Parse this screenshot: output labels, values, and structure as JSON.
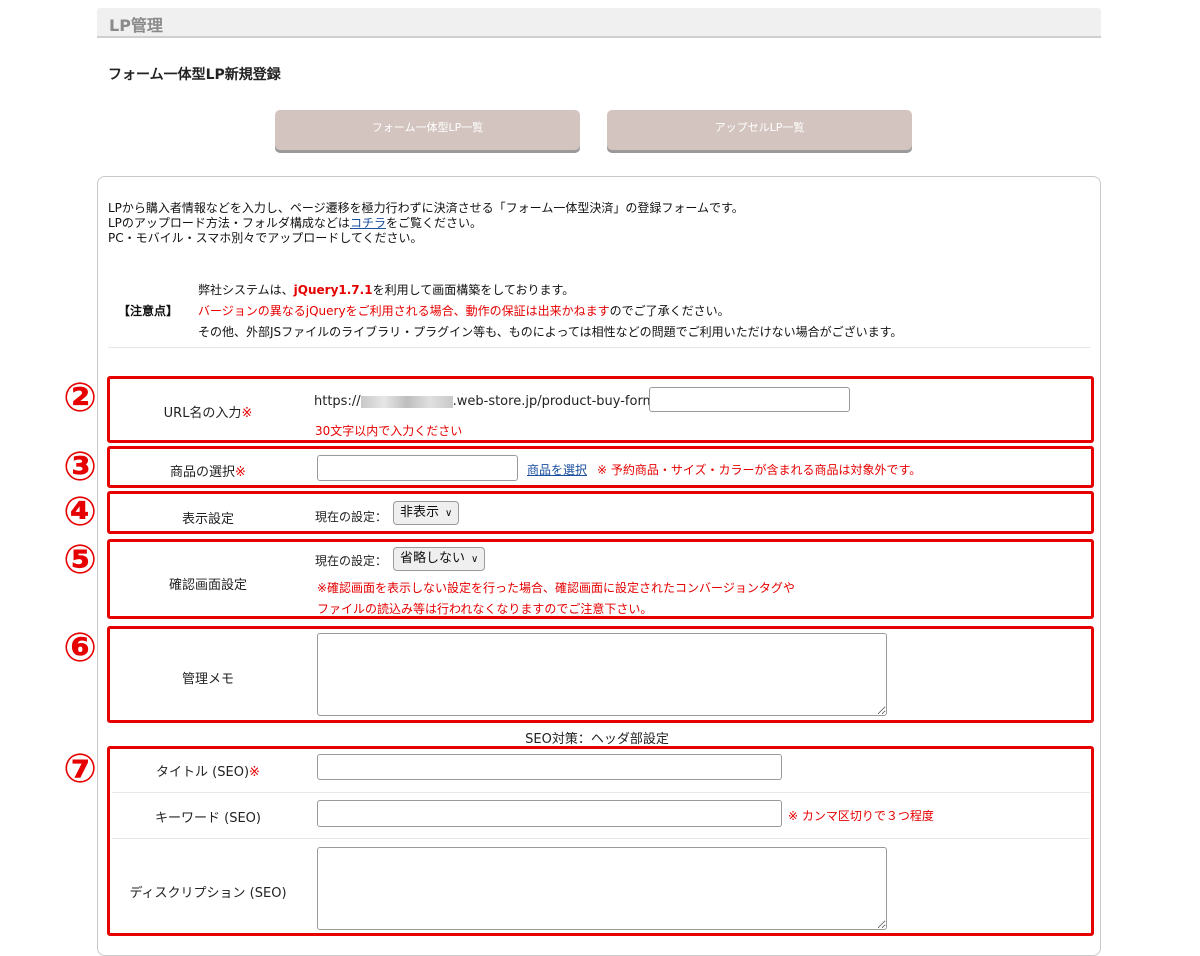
{
  "header": {
    "title": "LP管理"
  },
  "page_title": "フォーム一体型LP新規登録",
  "nav": {
    "btn_list": "フォーム一体型LP一覧",
    "btn_upsell": "アップセルLP一覧"
  },
  "intro": {
    "line1": "LPから購入者情報などを入力し、ページ遷移を極力行わずに決済させる「フォーム一体型決済」の登録フォームです。",
    "line2_before": "LPのアップロード方法・フォルダ構成などは",
    "line2_link": "コチラ",
    "line2_after": "をご覧ください。",
    "line3": "PC・モバイル・スマホ別々でアップロードしてください。"
  },
  "notice": {
    "label": "【注意点】",
    "line1_before": "弊社システムは、",
    "line1_bold": "jQuery1.7.1",
    "line1_after": "を利用して画面構築をしております。",
    "line2_red": "バージョンの異なるjQueryをご利用される場合、動作の保証は出来かねます",
    "line2_after": "のでご了承ください。",
    "line3": "その他、外部JSファイルのライブラリ・プラグイン等も、ものによっては相性などの問題でご利用いただけない場合がございます。"
  },
  "markers": {
    "m2": "②",
    "m3": "③",
    "m4": "④",
    "m5": "⑤",
    "m6": "⑥",
    "m7": "⑦"
  },
  "required_mark": "※",
  "url": {
    "label": "URL名の入力",
    "prefix": "https://",
    "suffix": ".web-store.jp/product-buy-form/",
    "value": "",
    "hint": "30文字以内で入力ください"
  },
  "product": {
    "label": "商品の選択",
    "value": "",
    "link": "商品を選択",
    "note": "※ 予約商品・サイズ・カラーが含まれる商品は対象外です。"
  },
  "display": {
    "label": "表示設定",
    "current": "現在の設定：",
    "selected": "非表示"
  },
  "confirm": {
    "label": "確認画面設定",
    "current": "現在の設定：",
    "selected": "省略しない",
    "note1": "※確認画面を表示しない設定を行った場合、確認画面に設定されたコンバージョンタグや",
    "note2": "ファイルの読込み等は行われなくなりますのでご注意下さい。"
  },
  "memo": {
    "label": "管理メモ",
    "value": ""
  },
  "seo": {
    "heading": "SEO対策：ヘッダ部設定",
    "title_label": "タイトル (SEO)",
    "title_value": "",
    "keyword_label": "キーワード (SEO)",
    "keyword_value": "",
    "keyword_note": "※ カンマ区切りで３つ程度",
    "desc_label": "ディスクリプション (SEO)",
    "desc_value": ""
  },
  "colors": {
    "accent_red": "#e60000",
    "nav_button": "#d3c4bf",
    "link_blue": "#1a4fa0"
  },
  "icons": {
    "select_arrow": "chevron-down-icon",
    "resize": "resize-grip-icon"
  }
}
